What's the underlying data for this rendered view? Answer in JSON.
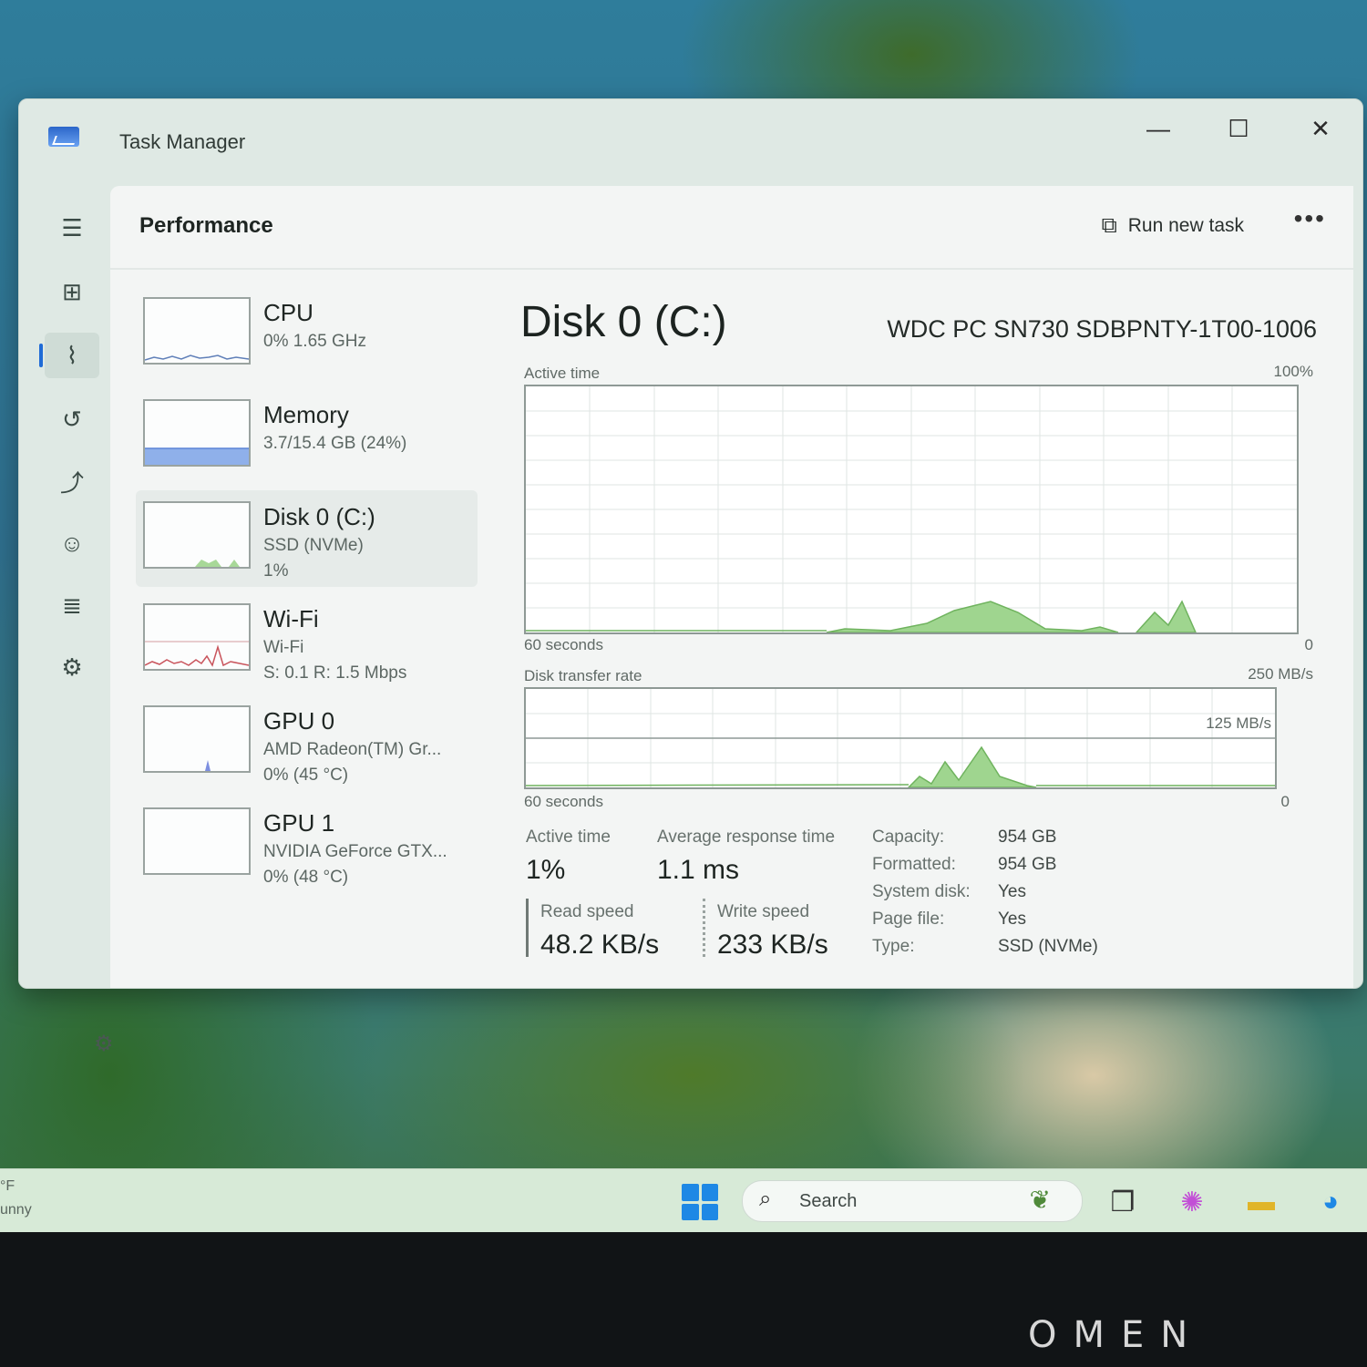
{
  "window": {
    "title": "Task Manager"
  },
  "window_controls": {
    "minimize": "—",
    "maximize": "☐",
    "close": "✕"
  },
  "nav": {
    "icons": [
      "hamburger-menu-icon",
      "processes-icon",
      "performance-icon",
      "app-history-icon",
      "startup-apps-icon",
      "users-icon",
      "details-icon",
      "services-icon"
    ],
    "active": "performance"
  },
  "header": {
    "title": "Performance",
    "run_new_task": "Run new task",
    "more": "•••"
  },
  "devices": [
    {
      "name": "CPU",
      "sub1": "0% 1.65 GHz",
      "sub2": ""
    },
    {
      "name": "Memory",
      "sub1": "3.7/15.4 GB (24%)",
      "sub2": ""
    },
    {
      "name": "Disk 0 (C:)",
      "sub1": "SSD (NVMe)",
      "sub2": "1%"
    },
    {
      "name": "Wi-Fi",
      "sub1": "Wi-Fi",
      "sub2": "S: 0.1 R: 1.5 Mbps"
    },
    {
      "name": "GPU 0",
      "sub1": "AMD Radeon(TM) Gr...",
      "sub2": "0% (45 °C)"
    },
    {
      "name": "GPU 1",
      "sub1": "NVIDIA GeForce GTX...",
      "sub2": "0% (48 °C)"
    }
  ],
  "detail": {
    "title": "Disk 0 (C:)",
    "model": "WDC PC SN730 SDBPNTY-1T00-1006",
    "active_graph": {
      "label": "Active time",
      "max": "100%",
      "x_left": "60 seconds",
      "x_right": "0"
    },
    "transfer_graph": {
      "label": "Disk transfer rate",
      "max": "250 MB/s",
      "mid": "125 MB/s",
      "x_left": "60 seconds",
      "x_right": "0"
    },
    "stats": {
      "active_time_label": "Active time",
      "active_time_value": "1%",
      "avg_response_label": "Average response time",
      "avg_response_value": "1.1 ms",
      "read_label": "Read speed",
      "read_value": "48.2 KB/s",
      "write_label": "Write speed",
      "write_value": "233 KB/s"
    },
    "properties": [
      {
        "key": "Capacity:",
        "value": "954 GB"
      },
      {
        "key": "Formatted:",
        "value": "954 GB"
      },
      {
        "key": "System disk:",
        "value": "Yes"
      },
      {
        "key": "Page file:",
        "value": "Yes"
      },
      {
        "key": "Type:",
        "value": "SSD (NVMe)"
      }
    ]
  },
  "taskbar": {
    "weather_line1": "°F",
    "weather_line2": "unny",
    "search_placeholder": "Search",
    "apps": [
      "task-view-icon",
      "copilot-icon",
      "file-explorer-icon",
      "edge-icon"
    ]
  },
  "laptop": {
    "brand": "OMEN"
  },
  "colors": {
    "accent": "#1f6bd6",
    "disk_green": "#7fc36b",
    "memory_blue": "#5b84d6",
    "wifi_red": "#c9545c"
  }
}
